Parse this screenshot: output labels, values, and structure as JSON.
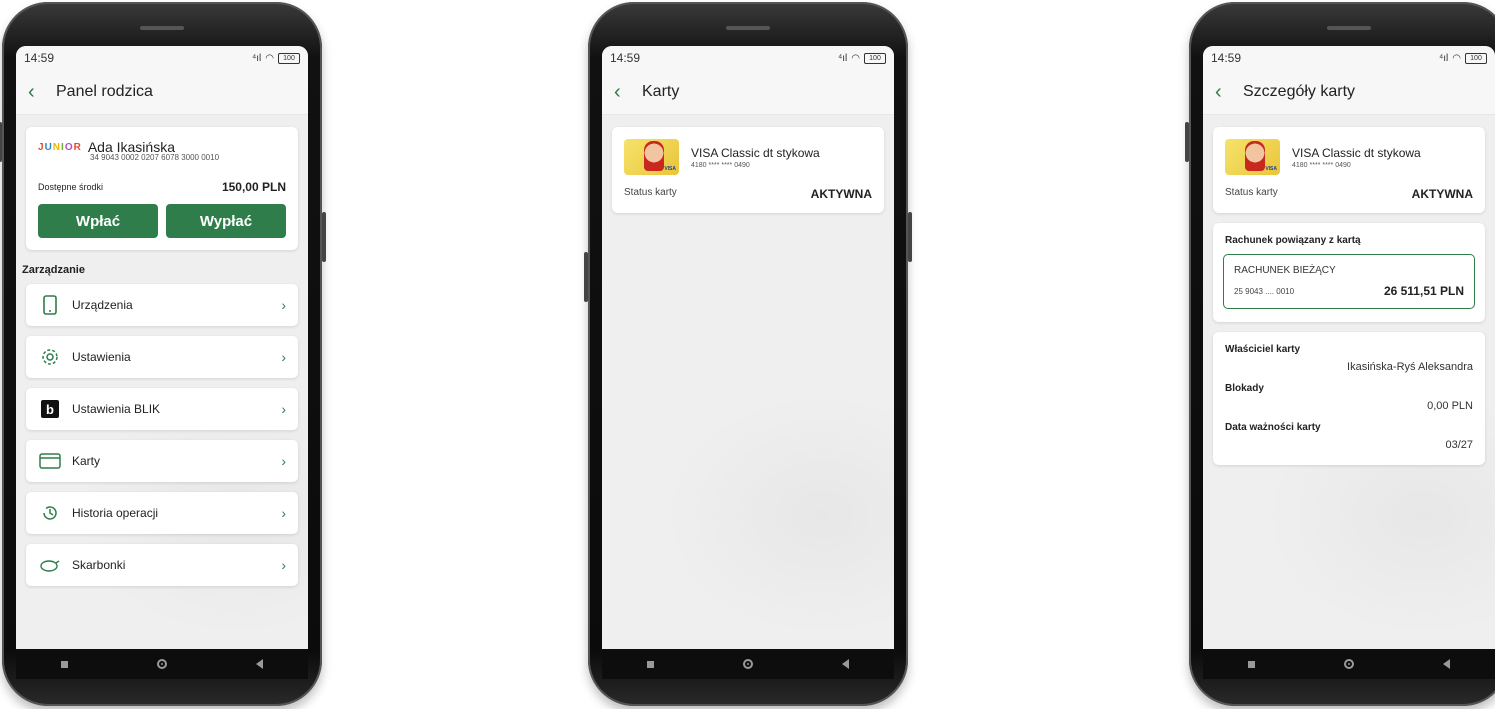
{
  "statusbar": {
    "time": "14:59",
    "signal": "⁴ıl",
    "wifi": "◠",
    "battery": "100"
  },
  "phone1": {
    "title": "Panel rodzica",
    "junior_logo": [
      "J",
      "U",
      "N",
      "I",
      "O",
      "R"
    ],
    "child_name": "Ada Ikasińska",
    "account_number": "34 9043 0002 0207 6078 3000 0010",
    "balance_label": "Dostępne środki",
    "balance_value": "150,00 PLN",
    "deposit_label": "Wpłać",
    "withdraw_label": "Wypłać",
    "section_title": "Zarządzanie",
    "menu": [
      {
        "label": "Urządzenia",
        "icon": "phone-icon"
      },
      {
        "label": "Ustawienia",
        "icon": "gear-icon"
      },
      {
        "label": "Ustawienia BLIK",
        "icon": "blik-icon"
      },
      {
        "label": "Karty",
        "icon": "card-icon"
      },
      {
        "label": "Historia operacji",
        "icon": "history-icon"
      },
      {
        "label": "Skarbonki",
        "icon": "piggy-bank-icon"
      }
    ]
  },
  "phone2": {
    "title": "Karty",
    "card_name": "VISA Classic dt stykowa",
    "card_number": "4180 **** **** 0490",
    "status_label": "Status karty",
    "status_value": "AKTYWNA"
  },
  "phone3": {
    "title": "Szczegóły karty",
    "card_name": "VISA Classic dt stykowa",
    "card_number": "4180 **** **** 0490",
    "status_label": "Status karty",
    "status_value": "AKTYWNA",
    "linked_title": "Rachunek powiązany z kartą",
    "account_name": "RACHUNEK BIEŻĄCY",
    "account_short": "25 9043 .... 0010",
    "account_balance": "26 511,51 PLN",
    "owner_label": "Właściciel karty",
    "owner_value": "Ikasińska-Ryś Aleksandra",
    "blocks_label": "Blokady",
    "blocks_value": "0,00 PLN",
    "expiry_label": "Data ważności karty",
    "expiry_value": "03/27"
  },
  "colors": {
    "accent": "#2e7d4a"
  }
}
